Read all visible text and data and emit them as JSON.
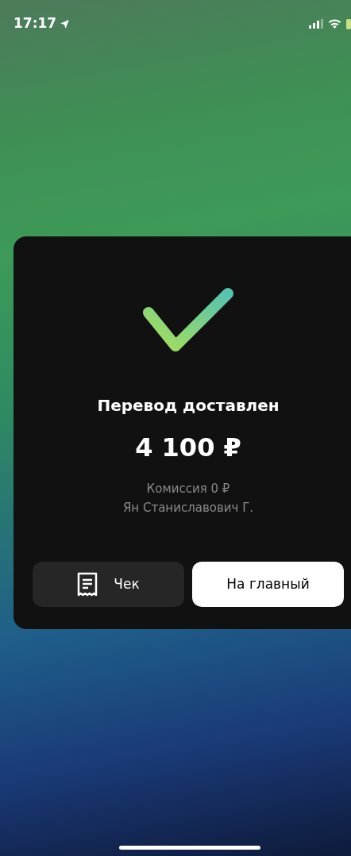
{
  "status_bar": {
    "time": "17:17"
  },
  "result": {
    "title": "Перевод доставлен",
    "amount": "4 100 ₽",
    "details": [
      "Комиссия 0 ₽",
      "Ян Станиславович Г."
    ]
  },
  "buttons": [
    {
      "label": "Чек",
      "kind": "secondary"
    },
    {
      "label": "На главный",
      "kind": "primary"
    }
  ]
}
